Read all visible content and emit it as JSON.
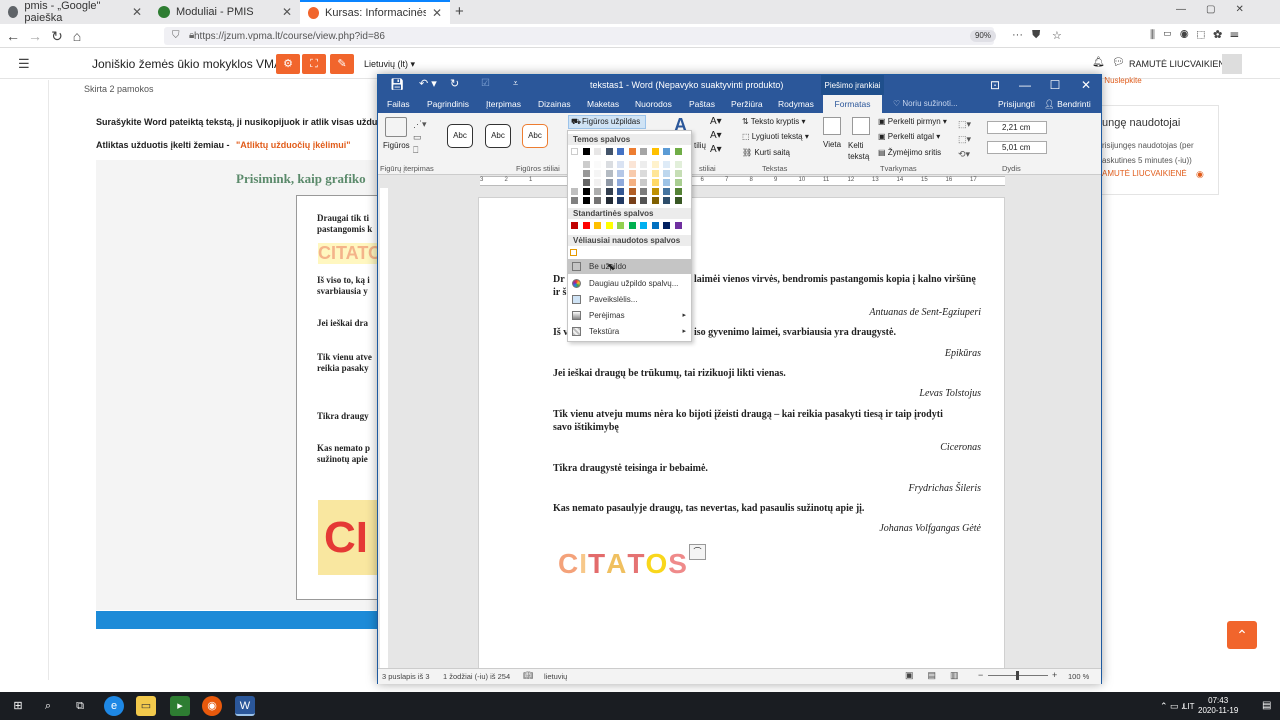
{
  "browser": {
    "tabs": [
      {
        "title": "pmis - „Google\" paieška",
        "icon_color": "#5f6368"
      },
      {
        "title": "Moduliai - PMIS",
        "icon_color": "#2e7d32"
      },
      {
        "title": "Kursas: Informacinės technolog",
        "icon_color": "#f1652c"
      }
    ],
    "url": "https://jzum.vpma.lt/course/view.php?id=86",
    "zoom": "90%"
  },
  "moodle": {
    "site_name": "Joniškio žemės ūkio mokyklos VMA",
    "language": "Lietuvių (lt)",
    "user_name": "RAMUTĖ LIUCVAIKIENĖ",
    "course_subtitle": "Skirta 2 pamokos",
    "instruction1": "Surašykite Word pateiktą tekstą, ji nusikopijuok ir atlik visas užduot",
    "instruction2": "Atliktas užduotis įkelti žemiau -",
    "instruction2_link": "\"Atliktų užduočių įkėlimui\"",
    "image_title": "Prisimink, kaip grafiko",
    "image_lines": [
      "Draugai tik ti",
      "pastangomis k",
      "CITATO",
      "Iš viso to, ką i",
      "svarbiausia y",
      "Jei ieškai dra",
      "Tik vienu atve",
      "reikia pasaky",
      "Tikra draugy",
      "Kas nemato p",
      "sužinotų apie",
      "CI"
    ],
    "right_top_link": "| Nuslepkite",
    "right_card_title": "ungę naudotojai",
    "right_card_line1": "risijungęs naudotojas (per",
    "right_card_line2": "askutines 5 minutes (-iu))",
    "right_card_user": "AMUTĖ LIUCVAIKIENĖ",
    "accent": "#f1652c"
  },
  "word": {
    "title": "tekstas1 - Word (Nepavyko suaktyvinti produkto)",
    "context_tab": "Piešimo įrankiai",
    "tabs": [
      "Failas",
      "Pagrindinis",
      "Įterpimas",
      "Dizainas",
      "Maketas",
      "Nuorodos",
      "Paštas",
      "Peržiūra",
      "Rodymas",
      "Formatas"
    ],
    "tell_me": "Noriu sužinoti...",
    "sign_in": "Prisijungti",
    "share": "Bendrinti",
    "ribbon": {
      "shapes": "Figūros",
      "insert_group": "Figūrų įterpimas",
      "styles_group": "Figūros stiliai",
      "abc": "Abc",
      "fill": "Figūros užpildas",
      "text_dir": "Teksto kryptis",
      "align_text": "Lygiuoti tekstą",
      "create_link": "Kurti saitą",
      "text_group": "Tekstas",
      "position": "Vieta",
      "wrap": "Kelti tekstą",
      "bring_forward": "Perkelti pirmyn",
      "send_backward": "Perkelti atgal",
      "selection_pane": "Žymėjimo sritis",
      "arrange_group": "Tvarkymas",
      "height": "2,21 cm",
      "width": "5,01 cm",
      "size_group": "Dydis",
      "wordart_styles": "stiliai",
      "text_fragment": "tilių"
    },
    "document": {
      "quotes": [
        {
          "text": "Dr",
          "text2": "laimėi vienos virvės, bendromis pastangomis kopia į kalno viršūnę",
          "text3": "ir š",
          "author": "Antuanas de Sent-Egziuperi"
        },
        {
          "text": "Iš v",
          "text2": "iso gyvenimo laimei, svarbiausia yra draugystė.",
          "author": "Epikūras"
        },
        {
          "text": "Jei ieškai draugų be trūkumų, tai rizikuoji likti vienas.",
          "author": "Levas Tolstojus"
        },
        {
          "text": "Tik vienu atveju mums nėra ko bijoti įžeisti draugą – kai reikia pasakyti tiesą ir taip įrodyti",
          "text2": "savo ištikimybę",
          "author": "Ciceronas"
        },
        {
          "text": "Tikra draugystė teisinga ir bebaimė.",
          "author": "Frydrichas Šileris"
        },
        {
          "text": "Kas nemato pasaulyje draugų, tas nevertas, kad pasaulis sužinotų apie jį.",
          "author": "Johanas Volfgangas Gėtė"
        }
      ],
      "wordart": [
        "C",
        "I",
        "T",
        "A",
        "T",
        "O",
        "S"
      ],
      "wordart_colors": [
        "#f4a27a",
        "#f7c88a",
        "#e36b6b",
        "#f0c060",
        "#e57373",
        "#f9d71c",
        "#ef8a8a"
      ]
    },
    "fill_menu": {
      "theme_header": "Temos spalvos",
      "standard_header": "Standartinės spalvos",
      "recent_header": "Vėliausiai naudotos spalvos",
      "theme_top": [
        "#ffffff",
        "#000000",
        "#e7e6e6",
        "#44546a",
        "#4472c4",
        "#ed7d31",
        "#a5a5a5",
        "#ffc000",
        "#5b9bd5",
        "#70ad47"
      ],
      "standard": [
        "#c00000",
        "#ff0000",
        "#ffc000",
        "#ffff00",
        "#92d050",
        "#00b050",
        "#00b0f0",
        "#0070c0",
        "#002060",
        "#7030a0"
      ],
      "recent": [
        "#ffffff"
      ],
      "items": [
        {
          "label": "Be užpildo",
          "icon": "no-fill-icon",
          "hover": true
        },
        {
          "label": "Daugiau užpildo spalvų...",
          "icon": "color-wheel-icon"
        },
        {
          "label": "Paveikslėlis...",
          "icon": "picture-icon"
        },
        {
          "label": "Perėjimas",
          "icon": "gradient-icon",
          "submenu": true
        },
        {
          "label": "Tekstūra",
          "icon": "texture-icon",
          "submenu": true
        }
      ]
    },
    "status": {
      "page": "3 puslapis iš 3",
      "words": "1 žodžiai (-iu) iš 254",
      "language": "lietuvių",
      "zoom": "100 %"
    }
  },
  "taskbar": {
    "time": "07:43",
    "date": "2020-11-19",
    "lang": "LIT"
  }
}
